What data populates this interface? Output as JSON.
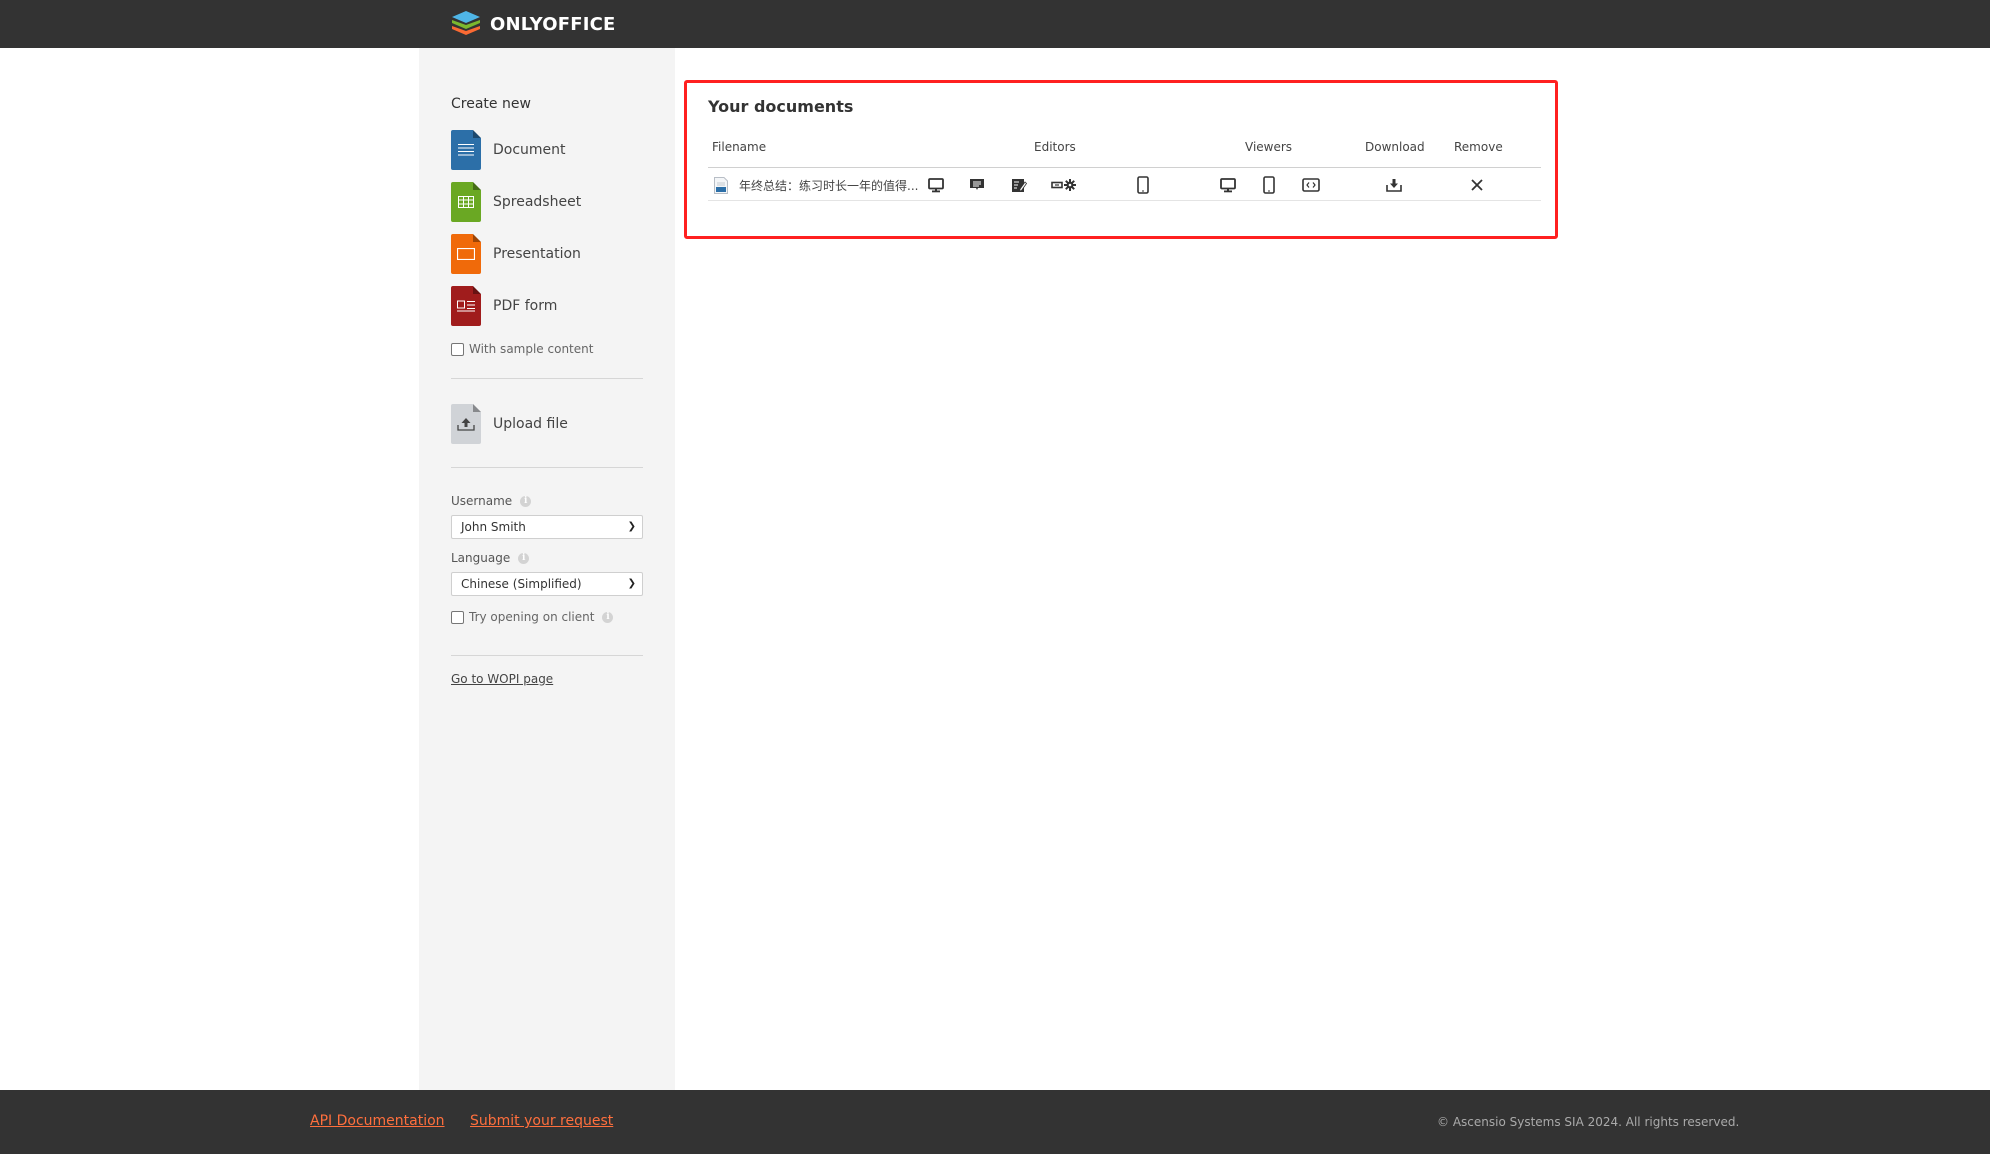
{
  "header": {
    "brand": "ONLYOFFICE",
    "logo_colors": [
      "#4fb5e6",
      "#7cb82f",
      "#fb6a33"
    ]
  },
  "sidebar": {
    "create_title": "Create new",
    "create_items": [
      {
        "label": "Document",
        "icon": "document-icon",
        "color": "#2c6fa8"
      },
      {
        "label": "Spreadsheet",
        "icon": "spreadsheet-icon",
        "color": "#6aa823"
      },
      {
        "label": "Presentation",
        "icon": "presentation-icon",
        "color": "#f06a0a"
      },
      {
        "label": "PDF form",
        "icon": "pdf-form-icon",
        "color": "#a01c1c"
      }
    ],
    "sample_content_label": "With sample content",
    "sample_content_checked": false,
    "upload_label": "Upload file",
    "username_label": "Username",
    "username_value": "John Smith",
    "language_label": "Language",
    "language_value": "Chinese (Simplified)",
    "try_client_label": "Try opening on client",
    "try_client_checked": false,
    "wopi_link": "Go to WOPI page"
  },
  "documents": {
    "title": "Your documents",
    "columns": {
      "filename": "Filename",
      "editors": "Editors",
      "viewers": "Viewers",
      "download": "Download",
      "remove": "Remove"
    },
    "files": [
      {
        "name": "年终总结：练习时长一年的值得...",
        "editor_icons": [
          "desktop-edit-icon",
          "comment-icon",
          "review-icon",
          "fill-form-settings-icon",
          "mobile-edit-icon"
        ],
        "viewer_icons": [
          "desktop-view-icon",
          "mobile-view-icon",
          "embedded-view-icon"
        ],
        "download_icon": "download-icon",
        "remove_icon": "remove-icon"
      }
    ]
  },
  "footer": {
    "api_docs": "API Documentation",
    "submit_request": "Submit your request",
    "copyright": "© Ascensio Systems SIA 2024. All rights reserved.",
    "link_color": "#ff6f3d"
  }
}
